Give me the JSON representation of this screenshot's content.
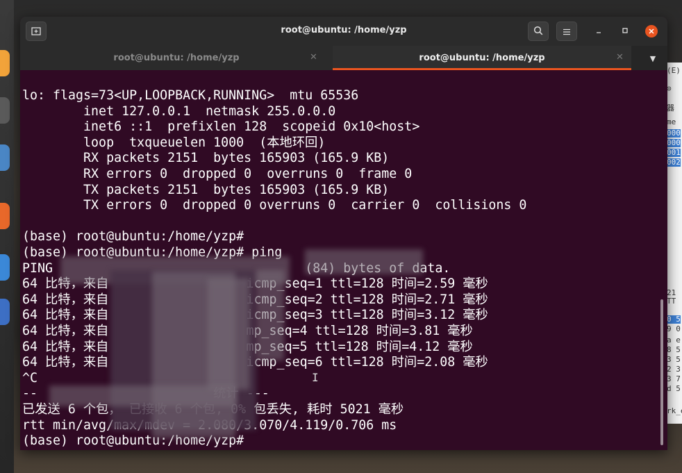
{
  "window": {
    "title": "root@ubuntu: /home/yzp"
  },
  "tabs": [
    {
      "label": "root@ubuntu: /home/yzp",
      "active": false
    },
    {
      "label": "root@ubuntu: /home/yzp",
      "active": true
    }
  ],
  "icons": {
    "new_tab": "new-tab-icon",
    "search": "search-icon",
    "menu": "hamburger-menu-icon",
    "minimize": "minimize-icon",
    "maximize": "maximize-icon",
    "close": "close-icon",
    "tab_close": "close-icon",
    "tab_dropdown": "chevron-down-icon"
  },
  "colors": {
    "terminal_bg": "#300a24",
    "accent": "#e95420",
    "text": "#ffffff"
  },
  "terminal": {
    "lines": [
      "lo: flags=73<UP,LOOPBACK,RUNNING>  mtu 65536",
      "        inet 127.0.0.1  netmask 255.0.0.0",
      "        inet6 ::1  prefixlen 128  scopeid 0x10<host>",
      "        loop  txqueuelen 1000  (本地环回)",
      "        RX packets 2151  bytes 165903 (165.9 KB)",
      "        RX errors 0  dropped 0  overruns 0  frame 0",
      "        TX packets 2151  bytes 165903 (165.9 KB)",
      "        TX errors 0  dropped 0 overruns 0  carrier 0  collisions 0",
      "",
      "(base) root@ubuntu:/home/yzp#",
      "(base) root@ubuntu:/home/yzp# ping",
      "PING                                 (84) bytes of data.",
      "64 比特，来自                  icmp_seq=1 ttl=128 时间=2.59 毫秒",
      "64 比特，来自                  icmp_seq=2 ttl=128 时间=2.71 毫秒",
      "64 比特，来自                  icmp_seq=3 ttl=128 时间=3.12 毫秒",
      "64 比特，来自                  mp_seq=4 ttl=128 时间=3.81 毫秒",
      "64 比特，来自                  mp_seq=5 ttl=128 时间=4.12 毫秒",
      "64 比特，来自                  icmp_seq=6 ttl=128 时间=2.08 毫秒",
      "^C",
      "--                       统计 ---",
      "已发送 6 个包， 已接收 6 个包, 0% 包丢失, 耗时 5021 毫秒",
      "rtt min/avg/max/mdev = 2.080/3.070/4.119/0.706 ms",
      "(base) root@ubuntu:/home/yzp#"
    ]
  },
  "background_window": {
    "fragments": [
      "(E)",
      "⊙",
      "器",
      "me",
      "000",
      "000",
      "001",
      "002",
      "21",
      "TT",
      "0 5",
      "9 0",
      "a e",
      "8 5",
      "3 5",
      "2 3",
      "3 7",
      "d 5",
      "rk_e"
    ]
  }
}
